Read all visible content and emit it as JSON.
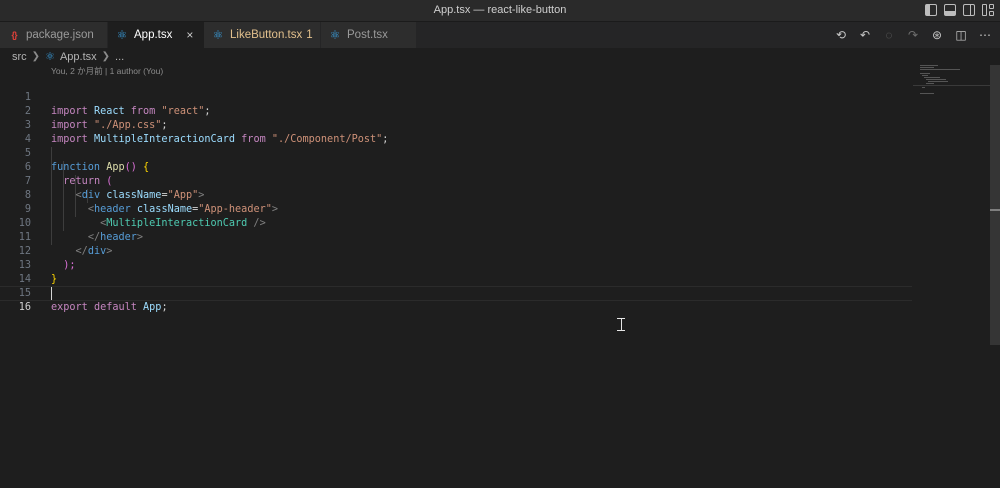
{
  "window": {
    "title": "App.tsx — react-like-button"
  },
  "tabs": [
    {
      "label": "package.json",
      "icon": "json-icon",
      "state": "inactive"
    },
    {
      "label": "App.tsx",
      "icon": "react-icon",
      "state": "active",
      "close": "×"
    },
    {
      "label": "LikeButton.tsx",
      "badge": "1",
      "icon": "react-icon",
      "state": "inactive",
      "color": "#e2c08d"
    },
    {
      "label": "Post.tsx",
      "icon": "react-icon",
      "state": "inactive"
    }
  ],
  "tab_actions": [
    "history-icon",
    "go-back-icon",
    "go-back-alt-icon",
    "go-forward-icon",
    "copilot-icon",
    "split-editor-icon",
    "more-actions-icon"
  ],
  "breadcrumb": {
    "folder": "src",
    "file": "App.tsx",
    "symbol": "..."
  },
  "blame": "You, 2 か月前 | 1 author (You)",
  "code_lines": [
    {
      "n": "1"
    },
    {
      "n": "2"
    },
    {
      "n": "3"
    },
    {
      "n": "4"
    },
    {
      "n": "5"
    },
    {
      "n": "6"
    },
    {
      "n": "7"
    },
    {
      "n": "8"
    },
    {
      "n": "9"
    },
    {
      "n": "10"
    },
    {
      "n": "11"
    },
    {
      "n": "12"
    },
    {
      "n": "13"
    },
    {
      "n": "14"
    },
    {
      "n": "15"
    },
    {
      "n": "16"
    }
  ],
  "code": {
    "l1": {
      "kw1": "import",
      "id": "React",
      "kw2": "from",
      "str": "\"react\"",
      "end": ";"
    },
    "l2": {
      "kw1": "import",
      "str": "\"./App.css\"",
      "end": ";"
    },
    "l3": {
      "kw1": "import",
      "id": "MultipleInteractionCard",
      "kw2": "from",
      "str": "\"./Component/Post\"",
      "end": ";"
    },
    "l5": {
      "kw": "function",
      "fn": "App",
      "paren": "()",
      "brace": "{"
    },
    "l6": {
      "kw": "return",
      "paren": "("
    },
    "l7": {
      "open": "<",
      "tag": "div",
      "attr": "className",
      "eq": "=",
      "str": "\"App\"",
      "close": ">"
    },
    "l8": {
      "open": "<",
      "tag": "header",
      "attr": "className",
      "eq": "=",
      "str": "\"App-header\"",
      "close": ">"
    },
    "l9": {
      "open": "<",
      "tag": "MultipleInteractionCard",
      "close": " />"
    },
    "l10": {
      "open": "</",
      "tag": "header",
      "close": ">"
    },
    "l11": {
      "open": "</",
      "tag": "div",
      "close": ">"
    },
    "l12": {
      "text": ");"
    },
    "l13": {
      "brace": "}"
    },
    "l15": {
      "kw1": "export",
      "kw2": "default",
      "id": "App",
      "end": ";"
    }
  },
  "colors": {
    "keyword": "#c586c0",
    "string": "#ce9178",
    "tag": "#4ec9b0",
    "attribute": "#9cdcfe",
    "function": "#dcdcaa"
  }
}
